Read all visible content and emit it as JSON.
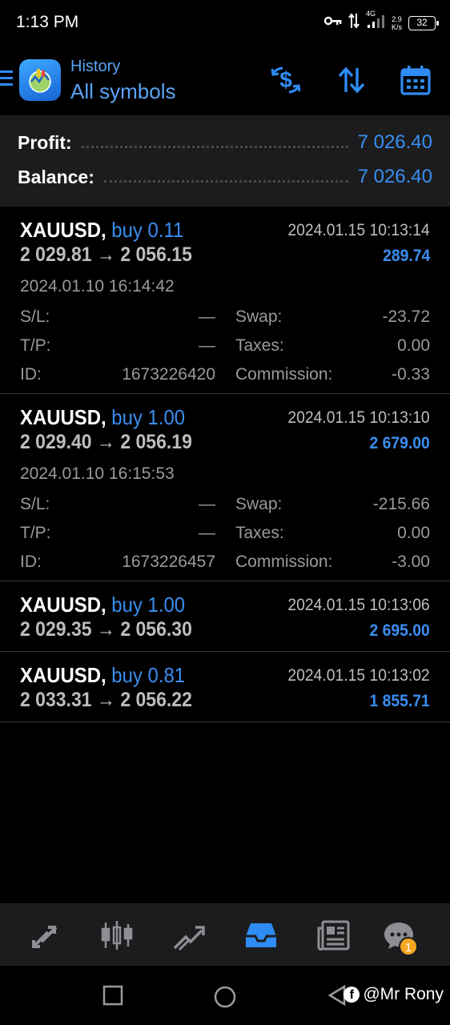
{
  "status_bar": {
    "time": "1:13 PM",
    "network": "4G",
    "speed_value": "2.9",
    "speed_unit": "K/s",
    "battery": "32",
    "icons": [
      "key-icon",
      "data-transfer-icon",
      "signal-icon",
      "battery-icon"
    ]
  },
  "header": {
    "subtitle": "History",
    "title": "All symbols",
    "actions": [
      "currency-exchange-icon",
      "sort-icon",
      "calendar-icon"
    ]
  },
  "summary": {
    "profit_label": "Profit:",
    "profit_value": "7 026.40",
    "balance_label": "Balance:",
    "balance_value": "7 026.40"
  },
  "deals": [
    {
      "symbol": "XAUUSD,",
      "side": "buy 0.11",
      "close_time": "2024.01.15 10:13:14",
      "price_open": "2 029.81",
      "arrow": "→",
      "price_close": "2 056.15",
      "profit": "289.74",
      "open_time": "2024.01.10 16:14:42",
      "sl_label": "S/L:",
      "sl_value": "—",
      "tp_label": "T/P:",
      "tp_value": "—",
      "id_label": "ID:",
      "id_value": "1673226420",
      "swap_label": "Swap:",
      "swap_value": "-23.72",
      "taxes_label": "Taxes:",
      "taxes_value": "0.00",
      "commission_label": "Commission:",
      "commission_value": "-0.33"
    },
    {
      "symbol": "XAUUSD,",
      "side": "buy 1.00",
      "close_time": "2024.01.15 10:13:10",
      "price_open": "2 029.40",
      "arrow": "→",
      "price_close": "2 056.19",
      "profit": "2 679.00",
      "open_time": "2024.01.10 16:15:53",
      "sl_label": "S/L:",
      "sl_value": "—",
      "tp_label": "T/P:",
      "tp_value": "—",
      "id_label": "ID:",
      "id_value": "1673226457",
      "swap_label": "Swap:",
      "swap_value": "-215.66",
      "taxes_label": "Taxes:",
      "taxes_value": "0.00",
      "commission_label": "Commission:",
      "commission_value": "-3.00"
    },
    {
      "symbol": "XAUUSD,",
      "side": "buy 1.00",
      "close_time": "2024.01.15 10:13:06",
      "price_open": "2 029.35",
      "arrow": "→",
      "price_close": "2 056.30",
      "profit": "2 695.00"
    },
    {
      "symbol": "XAUUSD,",
      "side": "buy 0.81",
      "close_time": "2024.01.15 10:13:02",
      "price_open": "2 033.31",
      "arrow": "→",
      "price_close": "2 056.22",
      "profit": "1 855.71"
    }
  ],
  "bottom_nav": {
    "items": [
      "quotes-icon",
      "chart-icon",
      "trade-icon",
      "history-icon",
      "news-icon",
      "messages-icon"
    ],
    "active": "history-icon",
    "messages_badge": "1"
  },
  "watermark": {
    "fb_glyph": "f",
    "text": "@Mr Rony"
  },
  "colors": {
    "accent": "#3a8ef0",
    "panel": "#1c1c1e",
    "badge": "#f5a623"
  }
}
